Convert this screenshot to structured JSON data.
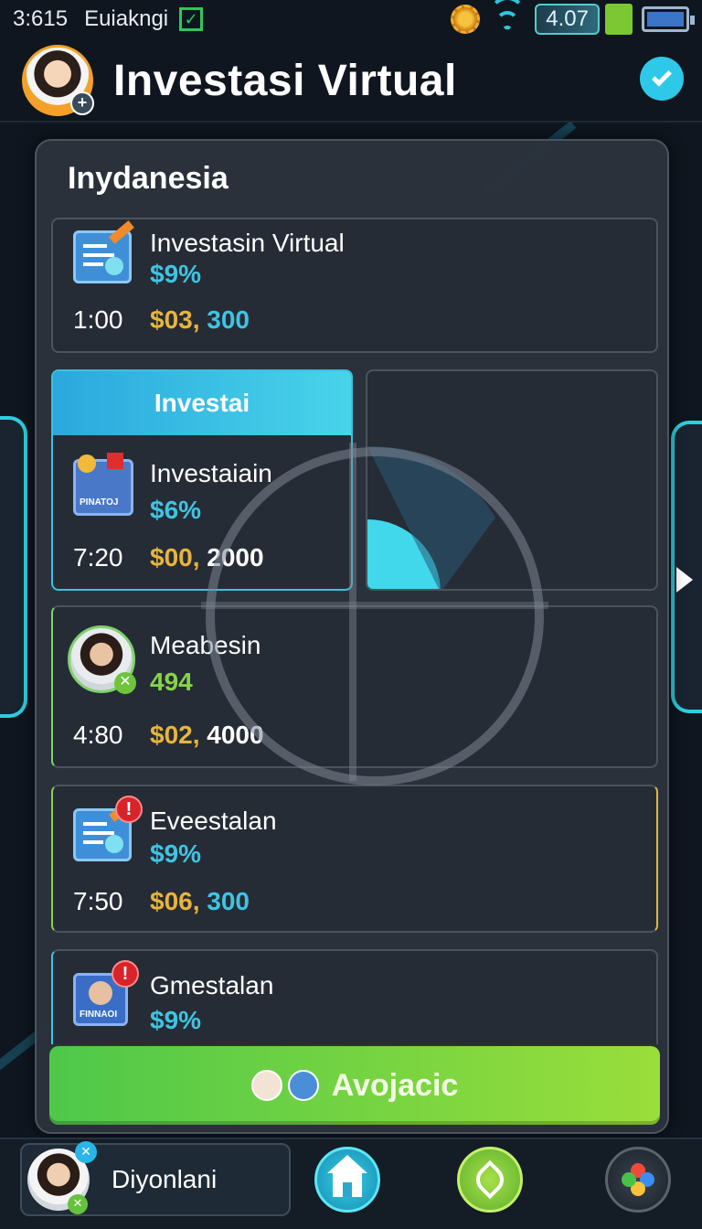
{
  "status_bar": {
    "time": "3:615",
    "carrier": "Euiakngi",
    "check": "✓",
    "signal_value": "4.07",
    "colors": {
      "wifi": "#2bc8e0",
      "battery": "#3c74c8",
      "check": "#2fc85a"
    }
  },
  "header": {
    "title": "Investasi Virtual",
    "avatar_badge": "+"
  },
  "panel": {
    "section_title": "Inydanesia"
  },
  "cards": [
    {
      "name": "Investasin Virtual",
      "percent": "$9%",
      "percent_color": "#3fc4e4",
      "time": "1:00",
      "amount_a": "$03",
      "amount_sep": ",",
      "amount_b": "300",
      "amount_b_color": "#3fc4e4",
      "icon": "document-chart-icon"
    },
    {
      "tab": "Investai",
      "name": "Investaiain",
      "percent": "$6%",
      "percent_color": "#3fc4e4",
      "time": "7:20",
      "amount_a": "$00",
      "amount_sep": ",",
      "amount_b": "2000",
      "amount_b_color": "#ffffff",
      "icon": "portfolio-chart-icon",
      "icon_label": "PINATOJ"
    },
    {
      "name": "Meabesin",
      "percent": "494",
      "percent_color": "#86d34a",
      "time": "4:80",
      "amount_a": "$02",
      "amount_sep": ",",
      "amount_b": "4000",
      "amount_b_color": "#ffffff",
      "icon": "investor-portrait-icon",
      "icon_badge": "✕"
    },
    {
      "name": "Eveestalan",
      "percent": "$9%",
      "percent_color": "#3fc4e4",
      "time": "7:50",
      "amount_a": "$06",
      "amount_sep": ",",
      "amount_b": "300",
      "amount_b_color": "#3fc4e4",
      "icon": "document-chart-icon",
      "alert": "!"
    },
    {
      "name": "Gmestalan",
      "percent": "$9%",
      "percent_color": "#3fc4e4",
      "icon": "profile-card-icon",
      "icon_label": "FINNAOI",
      "alert": "!"
    }
  ],
  "primary_button": {
    "label": "Avojacic"
  },
  "bottom_bar": {
    "user_name": "Diyonlani",
    "home": "home-icon",
    "leaf": "leaf-icon",
    "flower": "flower-icon"
  },
  "colors": {
    "accent": "#2ec9e8",
    "gold": "#e7b53c",
    "green": "#86d34a",
    "button_green": "#6ed040"
  }
}
